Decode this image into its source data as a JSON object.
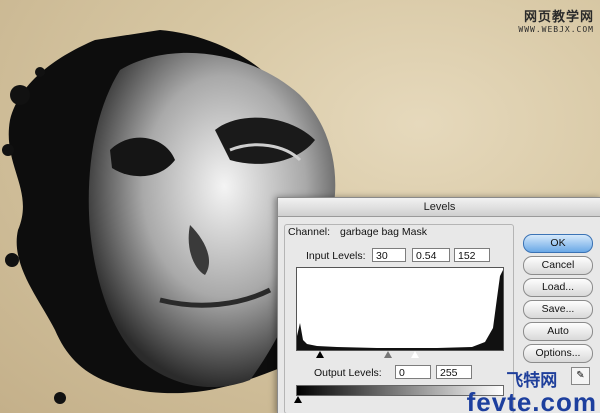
{
  "watermark_top": {
    "line1": "网页教学网",
    "line2": "WWW.WEBJX.COM"
  },
  "dialog": {
    "title": "Levels",
    "channel_label": "Channel:",
    "channel_value": "garbage bag Mask",
    "input_label": "Input Levels:",
    "input_values": [
      "30",
      "0.54",
      "152"
    ],
    "output_label": "Output Levels:",
    "output_values": [
      "0",
      "255"
    ],
    "buttons": {
      "ok": "OK",
      "cancel": "Cancel",
      "load": "Load...",
      "save": "Save...",
      "auto": "Auto",
      "options": "Options..."
    }
  },
  "watermark_bottom": {
    "line1": "飞特网",
    "line2": "fevte.com"
  },
  "colors": {
    "accent": "#3b73b5",
    "watermark": "#1d3f9e"
  }
}
